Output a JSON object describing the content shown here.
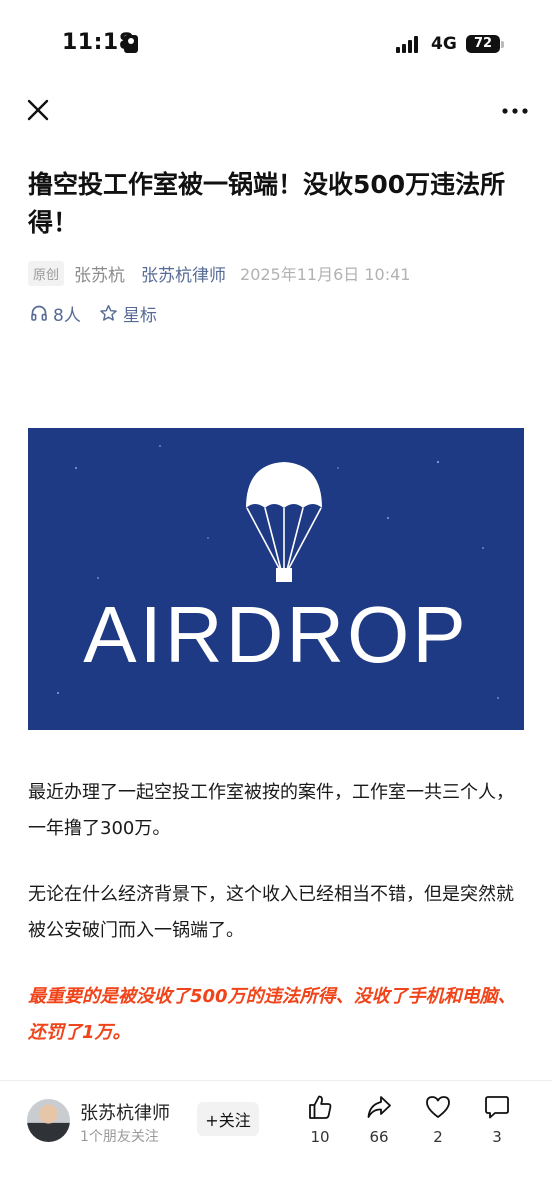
{
  "status_bar": {
    "time": "11:18",
    "network": "4G",
    "battery": "72"
  },
  "nav": {
    "close_icon": "close-icon",
    "more_icon": "more-icon"
  },
  "article": {
    "title": "撸空投工作室被一锅端！没收500万违法所得！",
    "original_tag": "原创",
    "author": "张苏杭",
    "account": "张苏杭律师",
    "publish_date": "2025年11月6日 10:41",
    "listen_count": "8人",
    "star_label": "星标",
    "cover_text": "AIRDROP",
    "paragraphs": [
      "最近办理了一起空投工作室被按的案件，工作室一共三个人，一年撸了300万。",
      "无论在什么经济背景下，这个收入已经相当不错，但是突然就被公安破门而入一锅端了。",
      "最重要的是被没收了500万的违法所得、没收了手机和电脑、还罚了1万。"
    ]
  },
  "bottom_bar": {
    "author_name": "张苏杭律师",
    "friend_follow": "1个朋友关注",
    "follow_label": "+关注",
    "likes": "10",
    "shares": "66",
    "favorites": "2",
    "comments": "3"
  },
  "colors": {
    "link": "#576b95",
    "highlight": "#f0441a",
    "cover_bg": "#1f3a84"
  }
}
